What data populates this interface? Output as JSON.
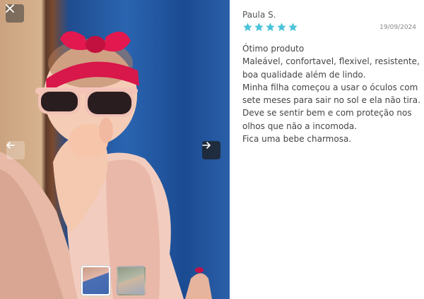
{
  "review": {
    "reviewer_name": "Paula S.",
    "rating": 5,
    "date": "19/09/2024",
    "star_color": "#4cc3d9",
    "lines": [
      "Ótimo produto",
      "Maleável, confortavel, flexivel, resistente,",
      "boa qualidade além de lindo.",
      "Minha filha começou a usar o óculos com",
      "sete meses para sair no sol e ela não tira.",
      "Deve se sentir bem e com proteção nos",
      "olhos que não a incomoda.",
      "Fica uma bebe charmosa."
    ]
  },
  "gallery": {
    "close_icon": "close-icon",
    "prev_icon": "arrow-left-icon",
    "next_icon": "arrow-right-icon",
    "thumbnails": [
      {
        "active": true
      },
      {
        "active": false
      }
    ]
  }
}
